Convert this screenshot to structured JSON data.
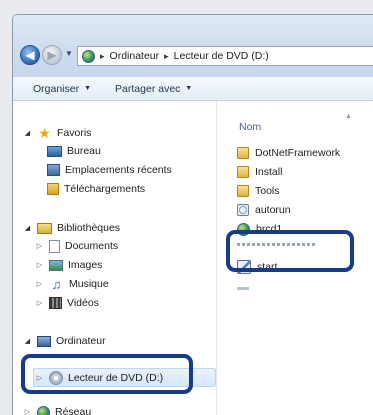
{
  "address": {
    "segments": [
      "Ordinateur",
      "Lecteur de DVD (D:)"
    ]
  },
  "toolbar": {
    "organize_label": "Organiser",
    "share_label": "Partager avec"
  },
  "nav": {
    "favorites": {
      "label": "Favoris",
      "items": [
        {
          "label": "Bureau",
          "icon": "desktop-icon"
        },
        {
          "label": "Emplacements récents",
          "icon": "recent-places-icon"
        },
        {
          "label": "Téléchargements",
          "icon": "downloads-icon"
        }
      ]
    },
    "libraries": {
      "label": "Bibliothèques",
      "items": [
        {
          "label": "Documents",
          "icon": "documents-icon"
        },
        {
          "label": "Images",
          "icon": "pictures-icon"
        },
        {
          "label": "Musique",
          "icon": "music-icon"
        },
        {
          "label": "Vidéos",
          "icon": "videos-icon"
        }
      ]
    },
    "computer": {
      "label": "Ordinateur",
      "selected_item": "Lecteur de DVD (D:)"
    },
    "network": {
      "label": "Réseau"
    }
  },
  "content": {
    "column_header": "Nom",
    "files": [
      {
        "name": "DotNetFramework",
        "icon": "folder-icon"
      },
      {
        "name": "Install",
        "icon": "folder-icon"
      },
      {
        "name": "Tools",
        "icon": "folder-icon"
      },
      {
        "name": "autorun",
        "icon": "settings-file-icon"
      },
      {
        "name": "brcd1",
        "icon": "globe-icon"
      },
      {
        "name": "start",
        "icon": "application-icon"
      }
    ]
  },
  "colors": {
    "highlight_outline": "#163c87",
    "selection_fill": "#d4e7fa"
  }
}
